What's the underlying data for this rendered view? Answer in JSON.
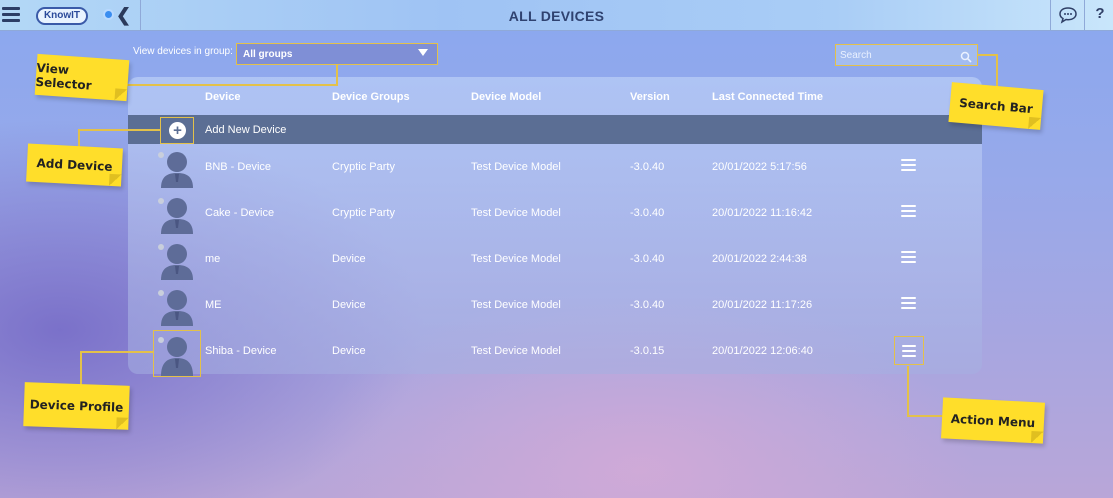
{
  "topbar": {
    "logo_text": "KnowIT",
    "title": "ALL DEVICES",
    "help_label": "?",
    "back_label": "❮"
  },
  "filter": {
    "label": "View devices in group:",
    "selected": "All groups"
  },
  "search": {
    "placeholder": "Search"
  },
  "table": {
    "headers": [
      "Device",
      "Device Groups",
      "Device Model",
      "Version",
      "Last Connected Time"
    ],
    "add_label": "Add New Device",
    "rows": [
      {
        "device": "BNB - Device",
        "group": "Cryptic Party",
        "model": "Test Device Model",
        "version": "-3.0.40",
        "last": "20/01/2022 5:17:56"
      },
      {
        "device": "Cake - Device",
        "group": "Cryptic Party",
        "model": "Test Device Model",
        "version": "-3.0.40",
        "last": "20/01/2022 11:16:42"
      },
      {
        "device": "me",
        "group": "Device",
        "model": "Test Device Model",
        "version": "-3.0.40",
        "last": "20/01/2022 2:44:38"
      },
      {
        "device": "ME",
        "group": "Device",
        "model": "Test Device Model",
        "version": "-3.0.40",
        "last": "20/01/2022 11:17:26"
      },
      {
        "device": "Shiba - Device",
        "group": "Device",
        "model": "Test Device Model",
        "version": "-3.0.15",
        "last": "20/01/2022 12:06:40"
      }
    ]
  },
  "annotations": {
    "view_selector": "View Selector",
    "add_device": "Add Device",
    "device_profile": "Device Profile",
    "search_bar": "Search Bar",
    "action_menu": "Action Menu"
  },
  "colors": {
    "note": "#ffde2a",
    "highlight": "#e3c14a",
    "add_row": "#5b6e94"
  },
  "icons": [
    "hamburger-icon",
    "back-icon",
    "chat-icon",
    "help-icon",
    "search-icon",
    "plus-icon",
    "avatar-icon",
    "menu-icon"
  ]
}
